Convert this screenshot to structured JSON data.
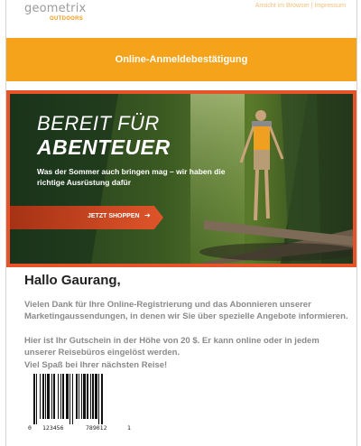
{
  "header": {
    "logo_main": "geometrix",
    "logo_sub": "OUTDOORS",
    "top_links": "Ansicht im Browser | Impressum"
  },
  "banner": {
    "title": "Online-Anmeldebestätigung"
  },
  "hero": {
    "title_line1": "BEREIT FÜR",
    "title_line2": "ABENTEUER",
    "text": "Was der Sommer auch bringen mag – wir haben die richtige Ausrüstung dafür",
    "cta_label": "JETZT SHOPPEN",
    "cta_icon": "arrow-right-icon"
  },
  "body": {
    "greeting": "Hallo Gaurang,",
    "paragraph1": "Vielen Dank für Ihre Online-Registrierung und das Abonnieren unserer Marketingaussendungen, in denen wir Sie über spezielle Angebote informieren.",
    "paragraph2": "Hier ist Ihr Gutschein in der Höhe von 20 $. Er kann online oder in jedem unserer Reisebüros eingelöst werden.",
    "paragraph3": "Viel Spaß bei Ihrer nächsten Reise!"
  },
  "barcode": {
    "digit_left": "0",
    "group1": "123456",
    "group2": "789012",
    "digit_right": "1"
  },
  "colors": {
    "accent_orange": "#f5a31b",
    "hero_border": "#e8542a",
    "text_gray": "#8a8a8a"
  }
}
